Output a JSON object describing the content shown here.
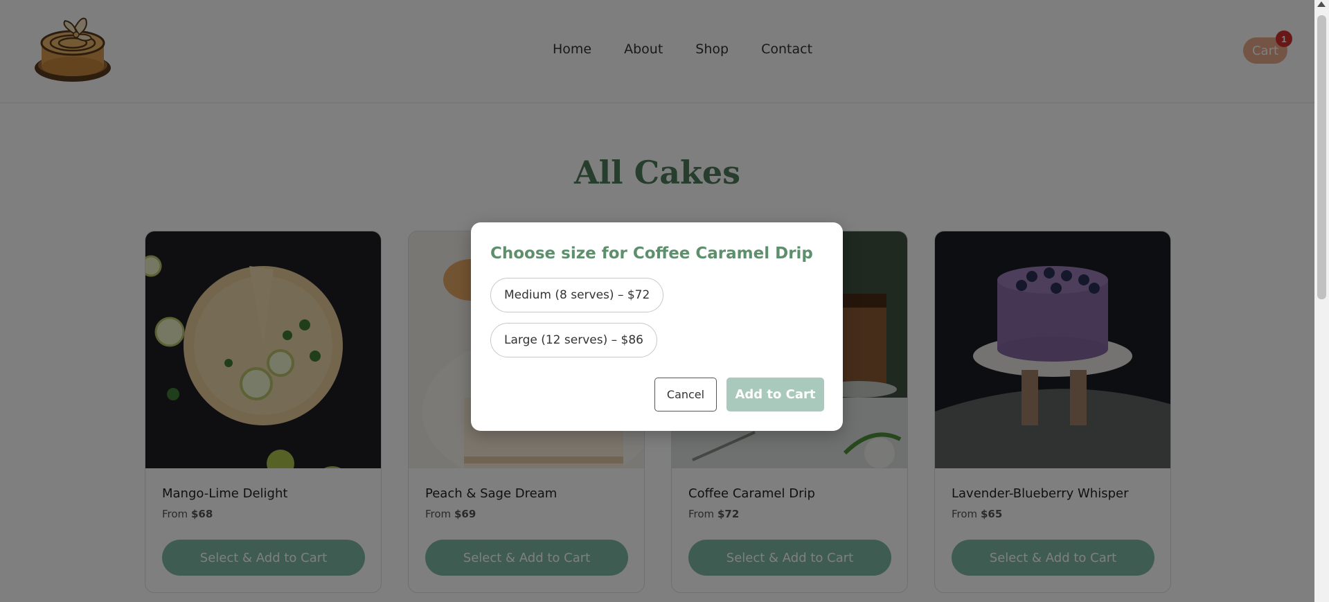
{
  "nav": {
    "items": [
      "Home",
      "About",
      "Shop",
      "Contact"
    ]
  },
  "cart": {
    "label": "Cart",
    "count": "1"
  },
  "main": {
    "title": "All Cakes"
  },
  "cards": [
    {
      "name": "Mango-Lime Delight",
      "from": "From",
      "price": "$68",
      "button": "Select & Add to Cart"
    },
    {
      "name": "Peach & Sage Dream",
      "from": "From",
      "price": "$69",
      "button": "Select & Add to Cart"
    },
    {
      "name": "Coffee Caramel Drip",
      "from": "From",
      "price": "$72",
      "button": "Select & Add to Cart"
    },
    {
      "name": "Lavender-Blueberry Whisper",
      "from": "From",
      "price": "$65",
      "button": "Select & Add to Cart"
    }
  ],
  "modal": {
    "title": "Choose size for Coffee Caramel Drip",
    "options": [
      "Medium (8 serves) – $72",
      "Large (12 serves) – $86"
    ],
    "cancel": "Cancel",
    "add": "Add to Cart"
  },
  "colors": {
    "accent_green": "#4f7a5a",
    "button_green": "#7fb8a4",
    "cart_orange": "#e6a98a",
    "badge_red": "#d32f2f"
  },
  "icons": [
    "cake-logo-icon",
    "scroll-up-arrow-icon"
  ]
}
